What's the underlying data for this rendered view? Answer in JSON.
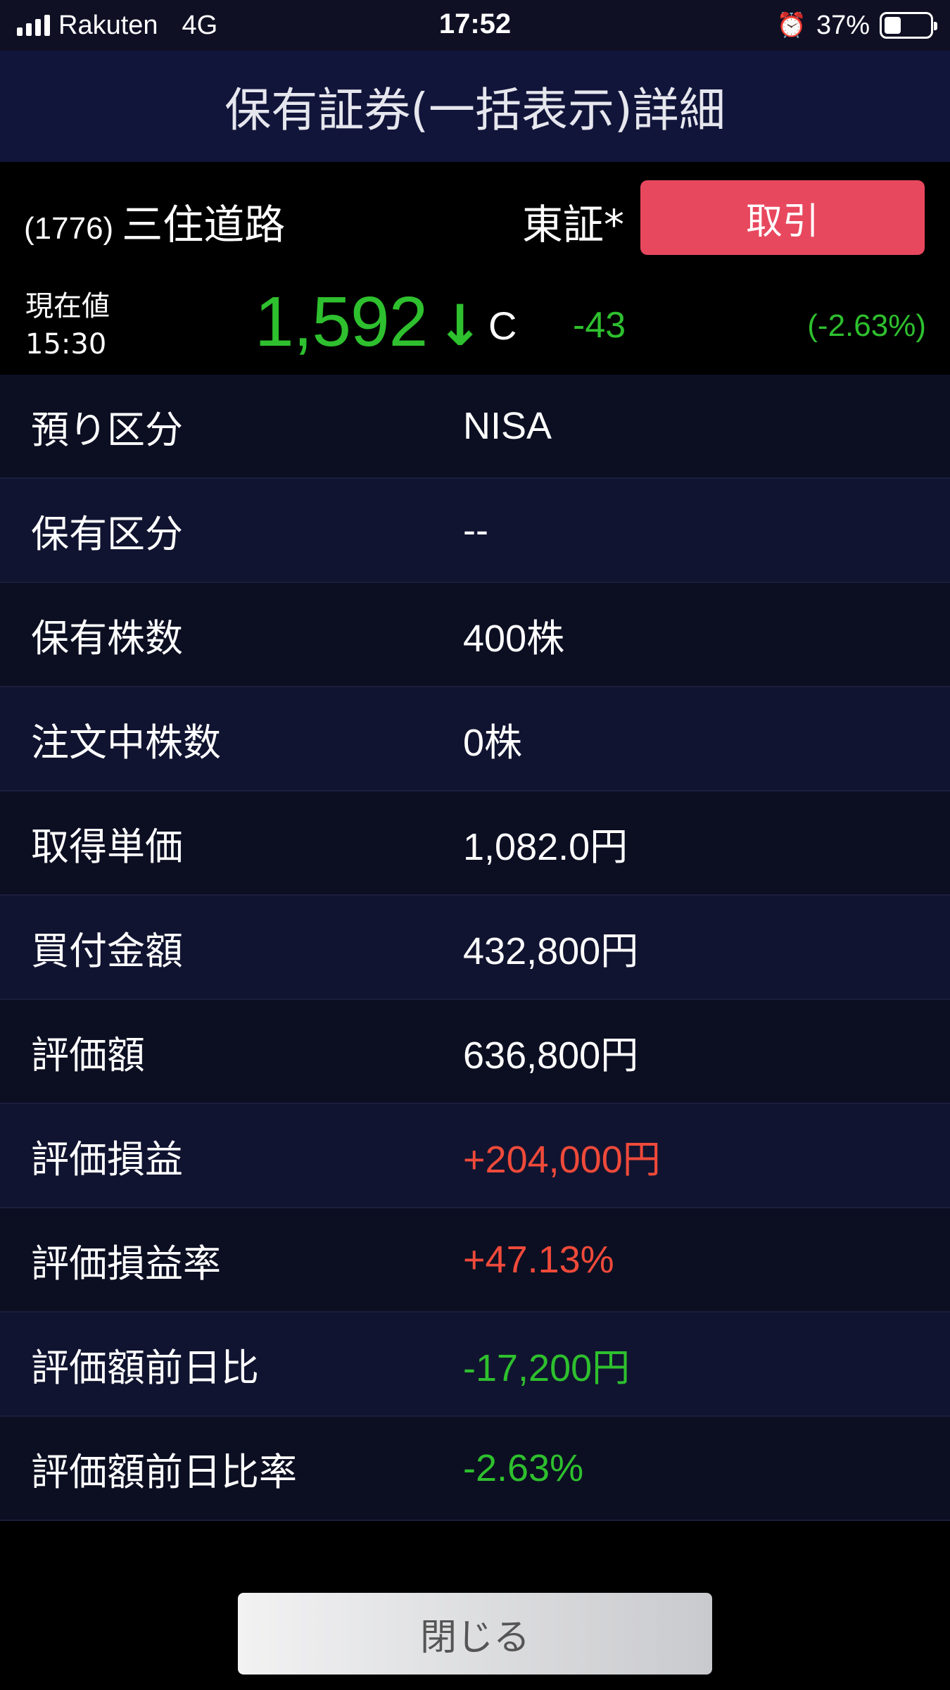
{
  "status_bar": {
    "carrier": "Rakuten",
    "network": "4G",
    "time": "17:52",
    "battery_percent_label": "37%",
    "battery_level": 0.37,
    "alarm_icon": "alarm-clock-icon",
    "signal_icon": "signal-bars-icon",
    "battery_icon": "battery-icon"
  },
  "nav": {
    "title": "保有証券(一括表示)詳細"
  },
  "stock": {
    "code": "(1776)",
    "name": "三住道路",
    "market": "東証*",
    "trade_button_label": "取引",
    "price_label": "現在値",
    "price_time": "15:30",
    "price": "1,592",
    "price_arrow": "↓",
    "price_flag": "C",
    "change": "-43",
    "change_pct": "(-2.63%)",
    "colors": {
      "down": "#2ec02e",
      "up": "#f04a3a",
      "trade_button": "#e8485e"
    }
  },
  "details": [
    {
      "label": "預り区分",
      "value": "NISA",
      "tone": "normal"
    },
    {
      "label": "保有区分",
      "value": "--",
      "tone": "normal"
    },
    {
      "label": "保有株数",
      "value": "400株",
      "tone": "normal"
    },
    {
      "label": "注文中株数",
      "value": "0株",
      "tone": "normal"
    },
    {
      "label": "取得単価",
      "value": "1,082.0円",
      "tone": "normal"
    },
    {
      "label": "買付金額",
      "value": "432,800円",
      "tone": "normal"
    },
    {
      "label": "評価額",
      "value": "636,800円",
      "tone": "normal"
    },
    {
      "label": "評価損益",
      "value": "+204,000円",
      "tone": "red"
    },
    {
      "label": "評価損益率",
      "value": "+47.13%",
      "tone": "red"
    },
    {
      "label": "評価額前日比",
      "value": "-17,200円",
      "tone": "green"
    },
    {
      "label": "評価額前日比率",
      "value": "-2.63%",
      "tone": "green"
    }
  ],
  "footer": {
    "close_button_label": "閉じる"
  }
}
